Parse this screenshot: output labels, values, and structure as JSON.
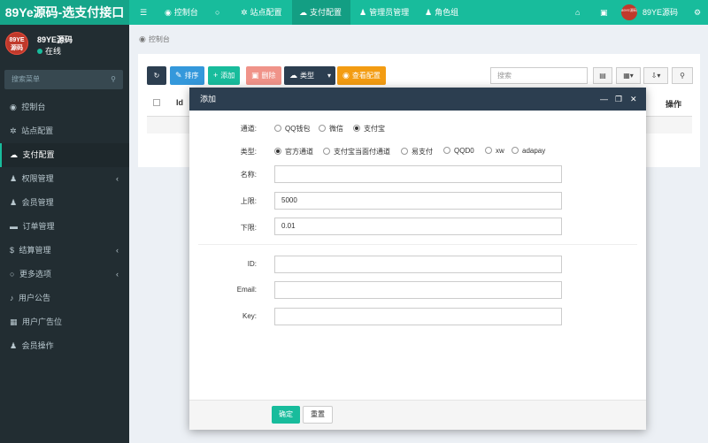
{
  "header": {
    "logo": "89Ye源码-选支付接口",
    "menu_icon": "☰",
    "nav": [
      {
        "icon": "dashboard-icon",
        "label": "控制台"
      },
      {
        "icon": "circle-icon",
        "label": ""
      },
      {
        "icon": "cog-icon",
        "label": "站点配置"
      },
      {
        "icon": "cloud-icon",
        "label": "支付配置"
      },
      {
        "icon": "user-icon",
        "label": "管理员管理"
      },
      {
        "icon": "users-icon",
        "label": "角色组"
      }
    ],
    "user_name": "89YE源码",
    "avatar_text": "89YE源码"
  },
  "sidebar": {
    "user_name": "89YE源码",
    "status": "在线",
    "avatar_text": "89YE源码",
    "search_placeholder": "搜索菜单",
    "items": [
      {
        "icon": "dashboard-icon",
        "label": "控制台",
        "arrow": false
      },
      {
        "icon": "cog-icon",
        "label": "站点配置",
        "arrow": false
      },
      {
        "icon": "cloud-icon",
        "label": "支付配置",
        "arrow": false,
        "active": true
      },
      {
        "icon": "group-icon",
        "label": "权限管理",
        "arrow": true
      },
      {
        "icon": "user-icon",
        "label": "会员管理",
        "arrow": false
      },
      {
        "icon": "briefcase-icon",
        "label": "订单管理",
        "arrow": false
      },
      {
        "icon": "dollar-icon",
        "label": "结算管理",
        "arrow": true
      },
      {
        "icon": "circle-icon",
        "label": "更多选项",
        "arrow": true
      },
      {
        "icon": "bell-icon",
        "label": "用户公告",
        "arrow": false
      },
      {
        "icon": "image-icon",
        "label": "用户广告位",
        "arrow": false
      },
      {
        "icon": "user-secret-icon",
        "label": "会员操作",
        "arrow": false
      }
    ]
  },
  "main": {
    "breadcrumb": "控制台",
    "toolbar": {
      "sort": "排序",
      "add": "添加",
      "delete": "删除",
      "type": "类型",
      "view_config": "查看配置",
      "search_placeholder": "搜索"
    },
    "table": {
      "col_id": "Id",
      "col_action": "操作"
    }
  },
  "modal": {
    "title": "添加",
    "channel_label": "通道:",
    "channel_options": [
      "QQ钱包",
      "微信",
      "支付宝"
    ],
    "channel_selected": 2,
    "type_label": "类型:",
    "type_options": [
      "官方通道",
      "支付宝当面付通道",
      "易支付",
      "QQD0",
      "xw",
      "adapay"
    ],
    "type_selected": 0,
    "name_label": "名称:",
    "name_value": "",
    "max_label": "上限:",
    "max_value": "5000",
    "min_label": "下限:",
    "min_value": "0.01",
    "id_label": "ID:",
    "id_value": "",
    "email_label": "Email:",
    "email_value": "",
    "key_label": "Key:",
    "key_value": "",
    "confirm": "确定",
    "reset": "重置"
  }
}
